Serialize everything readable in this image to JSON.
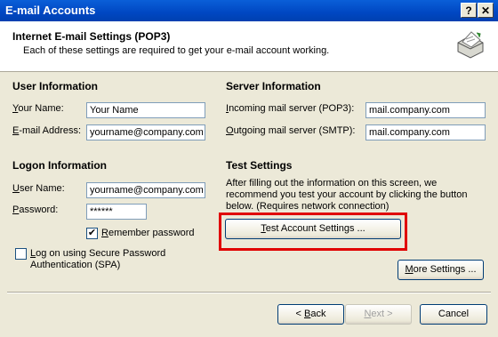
{
  "window": {
    "title": "E-mail Accounts",
    "help_label": "?",
    "close_label": "✕"
  },
  "header": {
    "title": "Internet E-mail Settings (POP3)",
    "subtitle": "Each of these settings are required to get your e-mail account working.",
    "icon": "email-settings-icon"
  },
  "user_info": {
    "heading": "User Information",
    "name_label_first": "Y",
    "name_label_rest": "our Name:",
    "name_value": "Your Name",
    "email_label_first": "E",
    "email_label_rest": "-mail Address:",
    "email_value": "yourname@company.com"
  },
  "server_info": {
    "heading": "Server Information",
    "incoming_label_first": "I",
    "incoming_label_rest": "ncoming mail server (POP3):",
    "incoming_value": "mail.company.com",
    "outgoing_label_first": "O",
    "outgoing_label_rest": "utgoing mail server (SMTP):",
    "outgoing_value": "mail.company.com"
  },
  "logon_info": {
    "heading": "Logon Information",
    "user_label_first": "U",
    "user_label_rest": "ser Name:",
    "user_value": "yourname@company.com",
    "password_label_first": "P",
    "password_label_rest": "assword:",
    "password_value": "******",
    "remember_first": "R",
    "remember_rest": "emember password",
    "remember_checked": true,
    "spa_first": "L",
    "spa_rest": "og on using Secure Password",
    "spa_line2": "Authentication (SPA)",
    "spa_checked": false
  },
  "test_settings": {
    "heading": "Test Settings",
    "description": "After filling out the information on this screen, we recommend you test your account by clicking the button below. (Requires network connection)",
    "test_label_first": "T",
    "test_label_rest": "est Account Settings ..."
  },
  "buttons": {
    "more_first": "M",
    "more_rest": "ore Settings ...",
    "back_prefix": "< ",
    "back_first": "B",
    "back_rest": "ack",
    "next_first": "N",
    "next_rest": "ext >",
    "cancel": "Cancel"
  },
  "colors": {
    "titlebar": "#0047c2",
    "highlight": "#e00000",
    "dialog": "#ece9d8"
  }
}
